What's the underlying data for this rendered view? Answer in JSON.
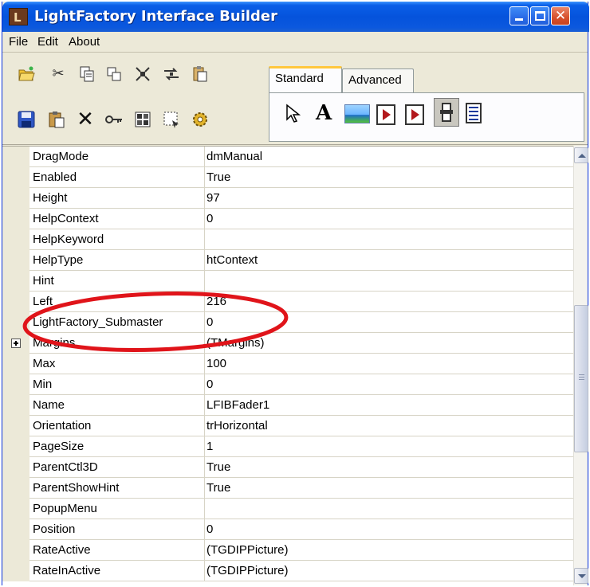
{
  "window": {
    "title": "LightFactory Interface Builder",
    "app_icon_letter": "L"
  },
  "menu": {
    "file": "File",
    "edit": "Edit",
    "about": "About"
  },
  "toolbar": {
    "icons": [
      "open-folder-icon",
      "cut-icon",
      "copy-icon",
      "copy-special-icon",
      "align-icon",
      "distribute-icon",
      "paste-special-icon",
      "save-icon",
      "paste-icon",
      "delete-icon",
      "key-icon",
      "grid-icon",
      "select-region-icon",
      "gear-icon"
    ]
  },
  "palette": {
    "tabs": [
      "Standard",
      "Advanced"
    ],
    "active_tab": "Standard",
    "label_glyph": "A",
    "components": [
      "pointer-icon",
      "label-icon",
      "image-icon",
      "button-icon",
      "button-alt-icon",
      "fader-icon",
      "memo-icon"
    ]
  },
  "properties": [
    {
      "name": "DragMode",
      "value": "dmManual"
    },
    {
      "name": "Enabled",
      "value": "True"
    },
    {
      "name": "Height",
      "value": "97"
    },
    {
      "name": "HelpContext",
      "value": "0"
    },
    {
      "name": "HelpKeyword",
      "value": ""
    },
    {
      "name": "HelpType",
      "value": "htContext"
    },
    {
      "name": "Hint",
      "value": ""
    },
    {
      "name": "Left",
      "value": "216"
    },
    {
      "name": "LightFactory_Submaster",
      "value": "0"
    },
    {
      "name": "Margins",
      "value": "(TMargins)",
      "expandable": true
    },
    {
      "name": "Max",
      "value": "100"
    },
    {
      "name": "Min",
      "value": "0"
    },
    {
      "name": "Name",
      "value": "LFIBFader1"
    },
    {
      "name": "Orientation",
      "value": "trHorizontal"
    },
    {
      "name": "PageSize",
      "value": "1"
    },
    {
      "name": "ParentCtl3D",
      "value": "True"
    },
    {
      "name": "ParentShowHint",
      "value": "True"
    },
    {
      "name": "PopupMenu",
      "value": ""
    },
    {
      "name": "Position",
      "value": "0"
    },
    {
      "name": "RateActive",
      "value": "(TGDIPPicture)"
    },
    {
      "name": "RateInActive",
      "value": "(TGDIPPicture)"
    }
  ],
  "colors": {
    "titlebar": "#0553dc",
    "annotation": "#e0141a",
    "tab_highlight": "#ffc73d"
  }
}
